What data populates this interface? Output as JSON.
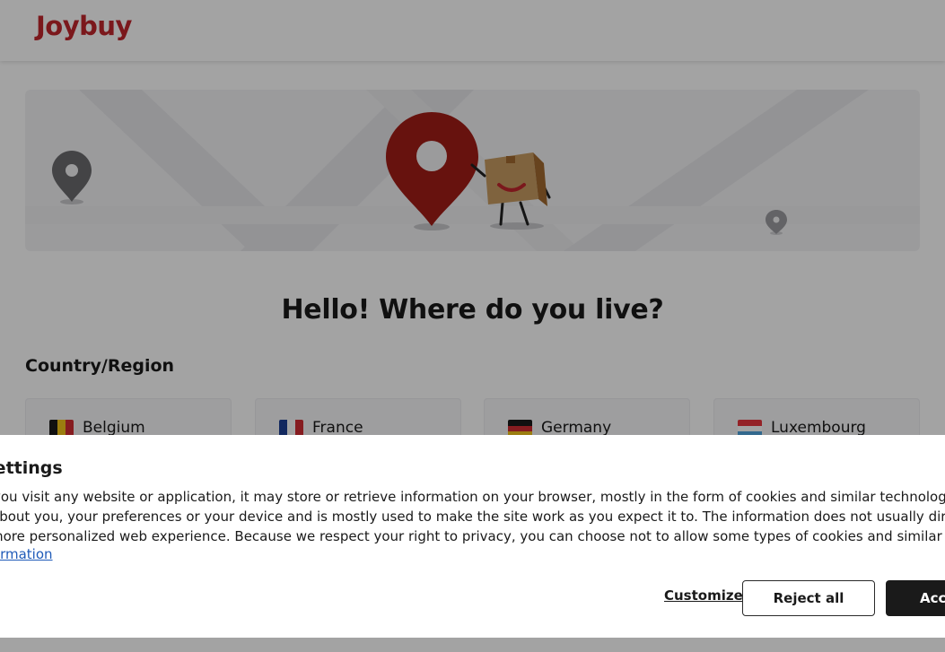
{
  "header": {
    "logo_text": "Joybuy"
  },
  "hero": {
    "icons": [
      "map-pin-icon",
      "delivery-box-mascot"
    ]
  },
  "page": {
    "title": "Hello! Where do you live?"
  },
  "countries": {
    "label": "Country/Region",
    "items": [
      {
        "name": "Belgium",
        "flag": [
          "#1a1a1a",
          "#f2c41a",
          "#d22c33"
        ]
      },
      {
        "name": "France",
        "flag": [
          "#1d3f95",
          "#ffffff",
          "#d22c33"
        ]
      },
      {
        "name": "Germany",
        "flag": [
          "#1a1a1a",
          "#d22c33",
          "#f2c41a"
        ]
      },
      {
        "name": "Luxembourg",
        "flag": [
          "#e8363d",
          "#ffffff",
          "#4fa3dd"
        ]
      }
    ]
  },
  "cookie": {
    "title": "Settings",
    "text_line1": "you visit any website or application, it may store or retrieve information on your browser, mostly in the form of cookies and similar technologies. This information",
    "text_line2": "about you, your preferences or your device and is mostly used to make the site work as you expect it to. The information does not usually directly identify you, but it",
    "text_line3": "more personalized web experience. Because we respect your right to privacy, you can choose not to allow some types of cookies and similar technologies.",
    "more_info_link": "More information",
    "customize_label": "Customize",
    "reject_label": "Reject all",
    "accept_label": "Accept all"
  },
  "colors": {
    "brand": "#c0262d",
    "link": "#1e5ab8",
    "overlay": "rgba(0,0,0,0.36)"
  }
}
